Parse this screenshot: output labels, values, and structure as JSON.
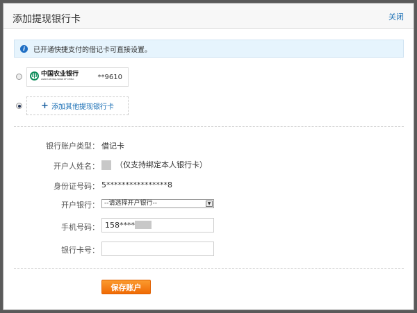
{
  "dialog": {
    "title": "添加提现银行卡",
    "close_label": "关闭"
  },
  "info": {
    "icon": "info-icon",
    "text": "已开通快捷支付的借记卡可直接设置。"
  },
  "cards": [
    {
      "bank_name": "中国农业银行",
      "bank_name_en": "AGRICULTURAL BANK OF CHINA",
      "number": "**9610",
      "selected": false
    }
  ],
  "add_card": {
    "label": "添加其他提现银行卡",
    "selected": true
  },
  "form": {
    "account_type_label": "银行账户类型：",
    "account_type_value": "借记卡",
    "holder_label": "开户人姓名：",
    "holder_note": "（仅支持绑定本人银行卡）",
    "id_label": "身份证号码：",
    "id_value": "5****************8",
    "bank_label": "开户银行：",
    "bank_value": "--请选择开户银行--",
    "phone_label": "手机号码：",
    "phone_value": "158****",
    "card_label": "银行卡号：",
    "card_value": ""
  },
  "save_label": "保存账户",
  "colors": {
    "accent": "#1a6fb5",
    "button": "#f47c12"
  }
}
